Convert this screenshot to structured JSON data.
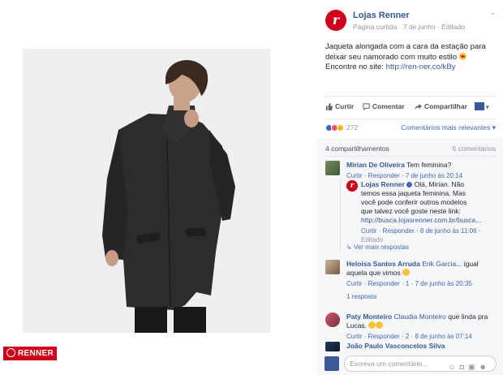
{
  "post": {
    "page_name": "Lojas Renner",
    "meta": "Página curtida · 7 de junho · Editado",
    "text": "Jaqueta alongada com a cara da estação para deixar seu namorado com muito estilo",
    "text_tail": " Encontre no site: ",
    "link": "http://ren-ner.co/kBy",
    "brand_logo_text": "RENNER"
  },
  "actions": {
    "like": "Curtir",
    "comment": "Comentar",
    "share": "Compartilhar"
  },
  "reactions": {
    "count": "272",
    "sort_label": "Comentários mais relevantes",
    "shares": "4 compartilhamentos",
    "comments": "6 comentários"
  },
  "comments": [
    {
      "name": "Mirian De Oliveira",
      "text": "Tem feminina?",
      "meta": "Curtir · Responder · 7 de junho às 20:14"
    },
    {
      "name": "Lojas Renner",
      "text": "Olá, Mirian. Não temos essa jaqueta feminina. Mas você pode conferir outros modelos que talvez você goste neste link: ",
      "link": "http://busca.lojasrenner.com.br/busca...",
      "meta": "Curtir · Responder · 8 de junho às 11:06 ·",
      "meta2": "Editado",
      "more": "Ver mais respostas"
    },
    {
      "name": "Heloisa Santos Arruda",
      "tag": "Erik Garcia",
      "text": "... igual aquela que vimos",
      "meta": "Curtir · Responder · 1 · 7 de junho às 20:35",
      "replies": "1 resposta"
    },
    {
      "name": "Paty Monteiro",
      "tag": "Claudia Monteiro",
      "text": "que linda pra Lucas.",
      "meta": "Curtir · Responder · 2 · 8 de junho às 07:14"
    },
    {
      "name": "João Paulo Vasconcelos Silva"
    }
  ],
  "composer": {
    "placeholder": "Escreva um comentário..."
  },
  "colors": {
    "brand": "#d0021b",
    "link": "#365899"
  }
}
